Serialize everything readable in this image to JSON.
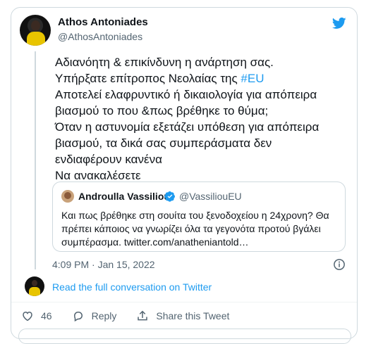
{
  "author": {
    "name": "Athos Antoniades",
    "handle": "@AthosAntoniades"
  },
  "tweet": {
    "lines": [
      "Αδιανόητη & επικίνδυνη η ανάρτηση σας.",
      "Υπήρξατε επίτροπος Νεολαίας της ",
      "Αποτελεί ελαφρυντικό ή δικαιολογία για απόπειρα",
      "βιασμού το που &πως βρέθηκε το θύμα;",
      "Όταν η αστυνομία εξετάζει υπόθεση για απόπειρα",
      "βιασμού, τα δικά σας συμπεράσματα δεν",
      "ενδιαφέρουν κανένα",
      "Να ανακαλέσετε"
    ],
    "hashtag": "#EU"
  },
  "quoted": {
    "name": "Androulla Vassiliou",
    "handle": "@VassiliouEU",
    "lines": [
      "Και πως βρέθηκε στη σουίτα του ξενοδοχείου η 24χρονη? Θα",
      "πρέπει κάποιος να γνωρίζει όλα τα γεγονότα προτού βγάλει",
      "συμπέρασμα. twitter.com/anatheniantold…"
    ]
  },
  "timestamp": "4:09 PM · Jan 15, 2022",
  "read_link": "Read the full conversation on Twitter",
  "actions": {
    "likes": "46",
    "reply": "Reply",
    "share": "Share this Tweet"
  },
  "colors": {
    "accent": "#1d9bf0",
    "like": "#536471"
  },
  "icons": [
    "twitter-bird-icon",
    "verified-badge-icon",
    "info-icon",
    "heart-icon",
    "reply-icon",
    "share-icon"
  ]
}
